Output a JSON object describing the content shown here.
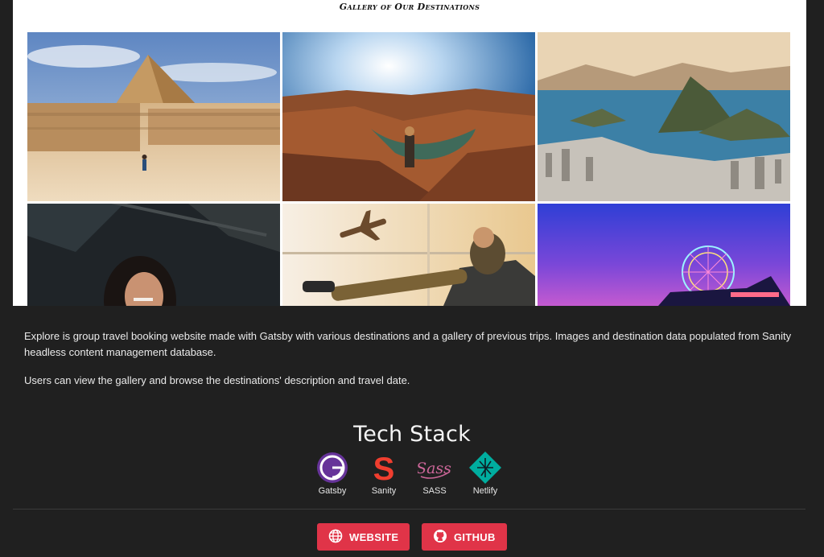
{
  "gallery": {
    "title": "Gallery of Our Destinations",
    "images": [
      {
        "alt": "Pyramid of Giza with the Sphinx and a walking traveler"
      },
      {
        "alt": "Hiker standing at the edge of Horseshoe Bend canyon"
      },
      {
        "alt": "Aerial view of Rio de Janeiro bay and Sugarloaf Mountain"
      },
      {
        "alt": "Smiling woman in a dark industrial setting"
      },
      {
        "alt": "Traveler relaxing in an airport lounge watching a plane"
      },
      {
        "alt": "Illuminated Ferris wheel on a pier at twilight"
      }
    ]
  },
  "description": {
    "paragraph1": "Explore is group travel booking website made with Gatsby with various destinations and a gallery of previous trips. Images and destination data populated from Sanity headless content management database.",
    "paragraph2": "Users can view the gallery and browse the destinations' description and travel date."
  },
  "tech_stack": {
    "title": "Tech Stack",
    "items": [
      {
        "label": "Gatsby",
        "icon": "gatsby-icon",
        "color": "#663399"
      },
      {
        "label": "Sanity",
        "icon": "sanity-icon",
        "color": "#f03e2f"
      },
      {
        "label": "SASS",
        "icon": "sass-icon",
        "color": "#cd6799"
      },
      {
        "label": "Netlify",
        "icon": "netlify-icon",
        "color": "#00ad9f"
      }
    ]
  },
  "buttons": {
    "website": "WEBSITE",
    "github": "GITHUB"
  },
  "colors": {
    "accent": "#e03448",
    "background": "#202020"
  }
}
